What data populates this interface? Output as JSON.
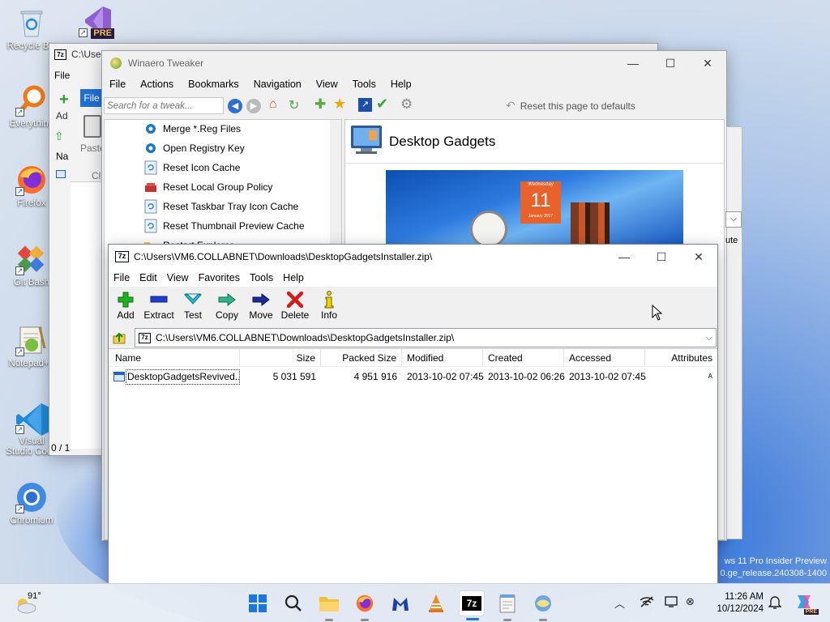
{
  "desktop": {
    "icons": [
      {
        "label": "Recycle Bin",
        "icon": "recycle-bin-icon"
      },
      {
        "label": "Everything",
        "icon": "everything-search-icon"
      },
      {
        "label": "Firefox",
        "icon": "firefox-icon"
      },
      {
        "label": "Git Bash",
        "icon": "git-bash-icon"
      },
      {
        "label": "Notepad++",
        "icon": "notepad-plus-plus-icon"
      },
      {
        "label": "Visual Studio Code",
        "icon": "vscode-icon"
      },
      {
        "label": "Chromium",
        "icon": "chromium-icon"
      }
    ],
    "vs_preview_badge": "PRE",
    "watermark": {
      "line1": "ws 11 Pro Insider Preview",
      "line2": "0.ge_release.240308-1400"
    }
  },
  "bg_window": {
    "title": "C:\\Users",
    "menu": "File",
    "tab": "File",
    "add": "Ad",
    "paste": "Paste",
    "clip": "Cli",
    "name_header": "Na",
    "status": "0 / 1"
  },
  "tweaker": {
    "title": "Winaero Tweaker",
    "menu": [
      "File",
      "Actions",
      "Bookmarks",
      "Navigation",
      "View",
      "Tools",
      "Help"
    ],
    "search_placeholder": "Search for a tweak...",
    "reset_page": "Reset this page to defaults",
    "tree": [
      {
        "label": "Merge *.Reg Files",
        "icon": "registry-cube-icon"
      },
      {
        "label": "Open Registry Key",
        "icon": "registry-cube-icon"
      },
      {
        "label": "Reset Icon Cache",
        "icon": "refresh-doc-icon"
      },
      {
        "label": "Reset Local Group Policy",
        "icon": "group-policy-icon"
      },
      {
        "label": "Reset Taskbar Tray Icon Cache",
        "icon": "refresh-doc-icon"
      },
      {
        "label": "Reset Thumbnail Preview Cache",
        "icon": "refresh-doc-icon"
      },
      {
        "label": "Restart Explorer",
        "icon": "folder-icon"
      }
    ],
    "panel_title": "Desktop Gadgets",
    "calendar_day": "11",
    "calendar_top": "Wednesday",
    "calendar_bottom": "January 2017",
    "right_header": "ute"
  },
  "zip": {
    "app_icon_text": "7z",
    "title": "C:\\Users\\VM6.COLLABNET\\Downloads\\DesktopGadgetsInstaller.zip\\",
    "menu": [
      "File",
      "Edit",
      "View",
      "Favorites",
      "Tools",
      "Help"
    ],
    "toolbar": [
      {
        "label": "Add",
        "icon": "plus-icon"
      },
      {
        "label": "Extract",
        "icon": "minus-icon"
      },
      {
        "label": "Test",
        "icon": "test-chevron-icon"
      },
      {
        "label": "Copy",
        "icon": "copy-arrow-icon"
      },
      {
        "label": "Move",
        "icon": "move-arrow-icon"
      },
      {
        "label": "Delete",
        "icon": "delete-x-icon"
      },
      {
        "label": "Info",
        "icon": "info-icon"
      }
    ],
    "address": "C:\\Users\\VM6.COLLABNET\\Downloads\\DesktopGadgetsInstaller.zip\\",
    "columns": [
      "Name",
      "Size",
      "Packed Size",
      "Modified",
      "Created",
      "Accessed",
      "Attributes"
    ],
    "rows": [
      {
        "name": "DesktopGadgetsRevived...",
        "size": "5 031 591",
        "packed": "4 951 916",
        "modified": "2013-10-02 07:45",
        "created": "2013-10-02 06:26",
        "accessed": "2013-10-02 07:45",
        "attributes": "A"
      }
    ]
  },
  "taskbar": {
    "weather_temp": "91°",
    "apps": [
      "start-icon",
      "search-icon",
      "file-explorer-icon",
      "firefox-icon",
      "malwarebytes-icon",
      "vlc-icon",
      "7zip-icon",
      "notepad-icon",
      "winaero-icon"
    ],
    "time": "11:26 AM",
    "date": "10/12/2024",
    "copilot_badge": "PRE"
  }
}
